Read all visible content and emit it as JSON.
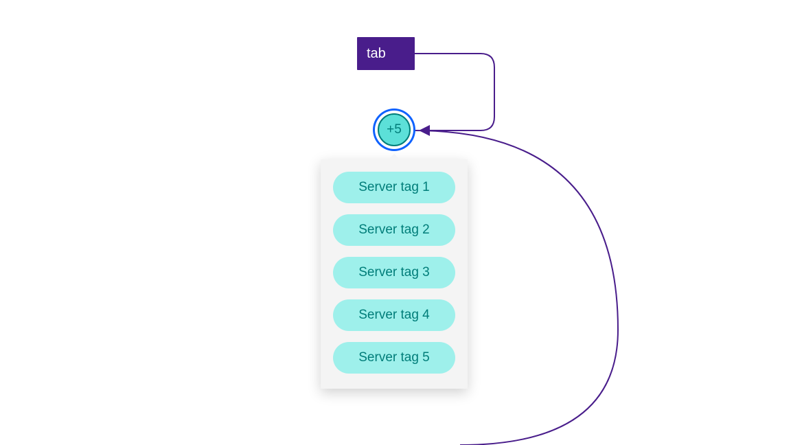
{
  "tab_key": {
    "label": "tab"
  },
  "count_badge": {
    "label": "+5"
  },
  "popover": {
    "tags": [
      {
        "label": "Server tag 1"
      },
      {
        "label": "Server tag 2"
      },
      {
        "label": "Server tag 3"
      },
      {
        "label": "Server tag 4"
      },
      {
        "label": "Server tag 5"
      }
    ]
  },
  "colors": {
    "purple": "#491d8b",
    "teal_fill": "#5ce0d8",
    "teal_light": "#9ef0eb",
    "teal_text": "#007d79",
    "focus_ring": "#0f62fe",
    "panel_bg": "#f4f4f4"
  }
}
